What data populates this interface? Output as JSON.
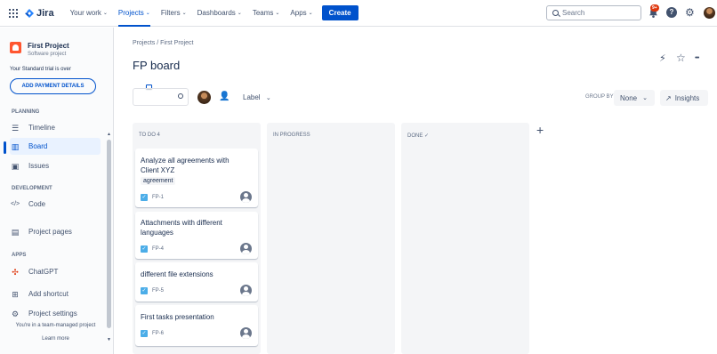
{
  "topnav": {
    "logo_text": "Jira",
    "items": [
      {
        "label": "Your work",
        "chevron": "⌄"
      },
      {
        "label": "Projects",
        "chevron": "⌄"
      },
      {
        "label": "Filters",
        "chevron": "⌄"
      },
      {
        "label": "Dashboards",
        "chevron": "⌄"
      },
      {
        "label": "Teams",
        "chevron": "⌄"
      },
      {
        "label": "Apps",
        "chevron": "⌄"
      }
    ],
    "create_label": "Create",
    "search_placeholder": "Search",
    "notifications_badge": "9+",
    "help_glyph": "?",
    "gear_glyph": "⚙"
  },
  "sidebar": {
    "project_name": "First Project",
    "project_type": "Software project",
    "trial_text": "Your Standard trial is over",
    "payment_button": "ADD PAYMENT DETAILS",
    "planning_label": "PLANNING",
    "planning_items": [
      {
        "label": "Timeline",
        "icon": "timeline-icon",
        "glyph": "☰"
      },
      {
        "label": "Board",
        "icon": "board-icon",
        "glyph": "▥"
      },
      {
        "label": "Issues",
        "icon": "issues-icon",
        "glyph": "▣"
      }
    ],
    "development_label": "DEVELOPMENT",
    "development_items": [
      {
        "label": "Code",
        "icon": "code-icon",
        "glyph": "</>"
      }
    ],
    "project_pages": {
      "label": "Project pages",
      "icon": "pages-icon",
      "glyph": "▤"
    },
    "apps_label": "APPS",
    "apps_items": [
      {
        "label": "ChatGPT",
        "icon": "chatgpt-icon",
        "glyph": "✣"
      },
      {
        "label": "Add shortcut",
        "icon": "add-shortcut-icon",
        "glyph": "⊞"
      },
      {
        "label": "Project settings",
        "icon": "settings-icon",
        "glyph": "⚙"
      }
    ],
    "footer_text": "You're in a team-managed project",
    "learn_more": "Learn more"
  },
  "main": {
    "breadcrumb": "Projects  /  First Project",
    "title": "FP board",
    "header_icons": [
      {
        "name": "automation-icon",
        "glyph": "⚡"
      },
      {
        "name": "star-icon",
        "glyph": "☆"
      },
      {
        "name": "more-icon",
        "glyph": "•••"
      }
    ],
    "add_people_glyph": "👤",
    "label_filter": "Label",
    "label_chevron": "⌄",
    "group_by_label": "GROUP BY",
    "group_by_value": "None",
    "group_by_chevron": "⌄",
    "insights_label": "Insights",
    "insights_glyph": "↗",
    "add_column_glyph": "+",
    "columns": [
      {
        "title": "TO DO 4"
      },
      {
        "title": "IN PROGRESS"
      },
      {
        "title": "DONE  ✓"
      }
    ],
    "cards": [
      {
        "title": "Analyze all agreements with Client XYZ",
        "tag": "agreement",
        "key": "FP-1"
      },
      {
        "title": "Attachments with different languages",
        "key": "FP-4"
      },
      {
        "title": "different file extensions",
        "key": "FP-5"
      },
      {
        "title": "First tasks presentation",
        "key": "FP-6"
      }
    ],
    "check_glyph": "✓"
  },
  "colors": {
    "accent": "#0052cc",
    "badge": "#de350b",
    "column_bg": "#f4f5f7",
    "story_check": "#4bade8"
  }
}
